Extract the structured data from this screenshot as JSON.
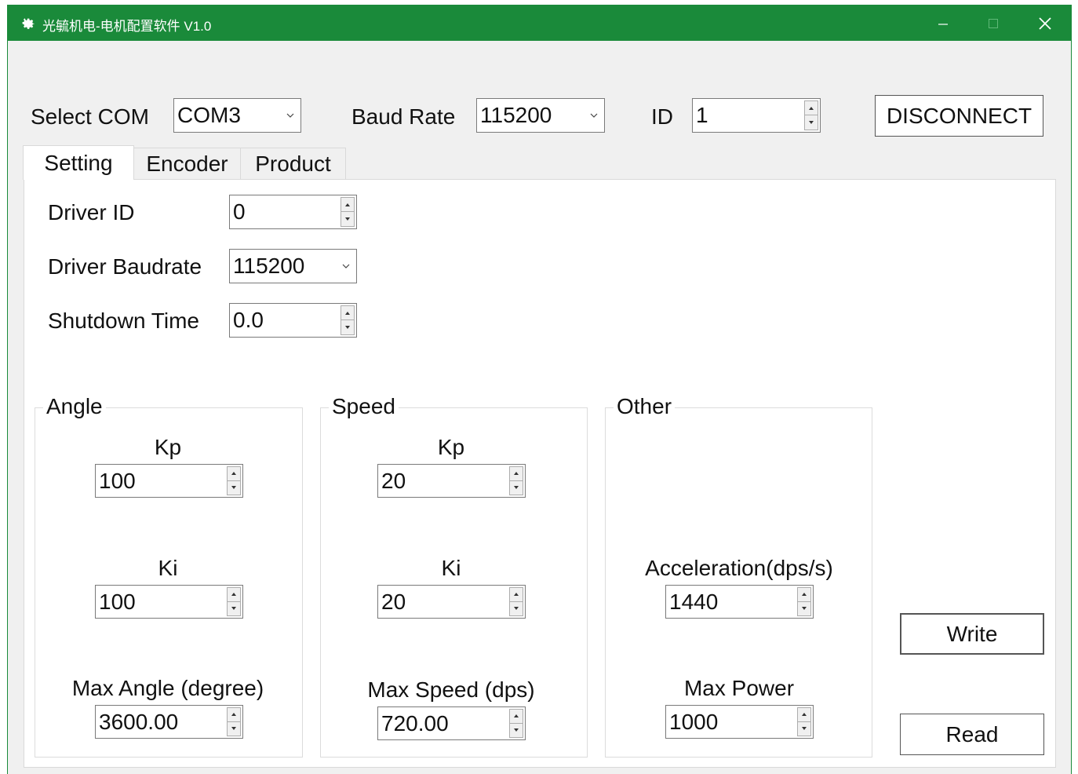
{
  "window": {
    "title": "光毓机电-电机配置软件 V1.0",
    "accent_color": "#1a8a3a",
    "icons": [
      "gear-icon",
      "minimize-icon",
      "maximize-icon",
      "close-icon"
    ]
  },
  "connection": {
    "com_label": "Select COM",
    "com_value": "COM3",
    "baud_label": "Baud Rate",
    "baud_value": "115200",
    "id_label": "ID",
    "id_value": "1",
    "disconnect_label": "DISCONNECT"
  },
  "tabs": [
    {
      "label": "Setting"
    },
    {
      "label": "Encoder"
    },
    {
      "label": "Product"
    }
  ],
  "setting": {
    "driver_id_label": "Driver ID",
    "driver_id_value": "0",
    "driver_baud_label": "Driver Baudrate",
    "driver_baud_value": "115200",
    "shutdown_label": "Shutdown Time",
    "shutdown_value": "0.0"
  },
  "angle": {
    "title": "Angle",
    "kp_label": "Kp",
    "kp_value": "100",
    "ki_label": "Ki",
    "ki_value": "100",
    "max_label": "Max Angle (degree)",
    "max_value": "3600.00"
  },
  "speed": {
    "title": "Speed",
    "kp_label": "Kp",
    "kp_value": "20",
    "ki_label": "Ki",
    "ki_value": "20",
    "max_label": "Max Speed (dps)",
    "max_value": "720.00"
  },
  "other": {
    "title": "Other",
    "accel_label": "Acceleration(dps/s)",
    "accel_value": "1440",
    "power_label": "Max Power",
    "power_value": "1000"
  },
  "actions": {
    "write_label": "Write",
    "read_label": "Read"
  }
}
